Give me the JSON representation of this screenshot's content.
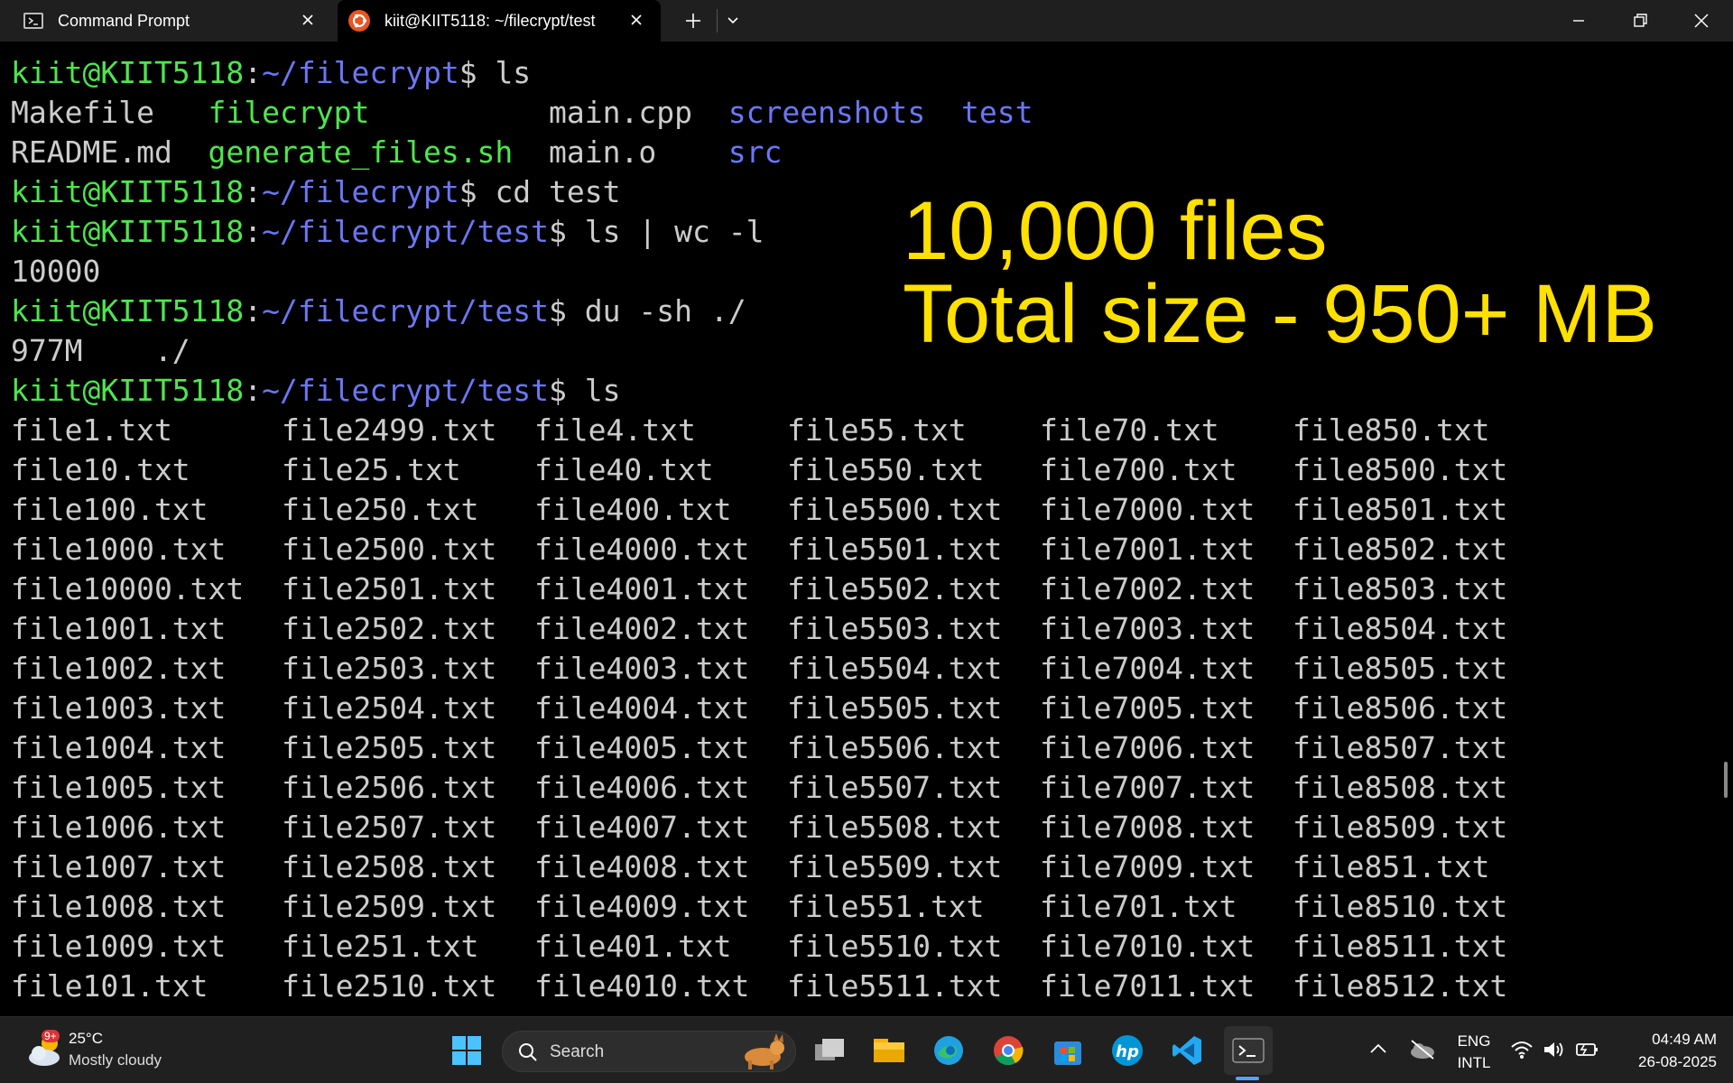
{
  "window": {
    "tabs": [
      {
        "label": "Command Prompt",
        "icon": "cmd-icon",
        "active": false
      },
      {
        "label": "kiit@KIIT5118: ~/filecrypt/test",
        "icon": "ubuntu-icon",
        "active": true
      }
    ],
    "controls": [
      "new-tab-icon",
      "dropdown-icon",
      "minimize-icon",
      "restore-icon",
      "close-icon"
    ]
  },
  "terminal": {
    "colors": {
      "prompt_user": "#4ee64e",
      "prompt_path": "#6b77f5",
      "text": "#cccccc",
      "overlay": "#ffe000"
    },
    "lines": [
      {
        "user": "kiit@KIIT5118",
        "sep": ":",
        "path": "~/filecrypt",
        "cmd": "$ ls"
      },
      {
        "text": "Makefile   ",
        "exec": "filecrypt",
        "text2": "          main.cpp  ",
        "dir1": "screenshots",
        "gap": "  ",
        "dir2": "test"
      },
      {
        "text": "README.md  ",
        "exec": "generate_files.sh",
        "text2": "  main.o    ",
        "dir1": "src"
      },
      {
        "user": "kiit@KIIT5118",
        "sep": ":",
        "path": "~/filecrypt",
        "cmd": "$ cd test"
      },
      {
        "user": "kiit@KIIT5118",
        "sep": ":",
        "path": "~/filecrypt/test",
        "cmd": "$ ls | wc -l"
      },
      {
        "text": "10000"
      },
      {
        "user": "kiit@KIIT5118",
        "sep": ":",
        "path": "~/filecrypt/test",
        "cmd": "$ du -sh ./"
      },
      {
        "text": "977M    ./"
      },
      {
        "user": "kiit@KIIT5118",
        "sep": ":",
        "path": "~/filecrypt/test",
        "cmd": "$ ls"
      }
    ],
    "file_columns": [
      [
        "file1.txt",
        "file10.txt",
        "file100.txt",
        "file1000.txt",
        "file10000.txt",
        "file1001.txt",
        "file1002.txt",
        "file1003.txt",
        "file1004.txt",
        "file1005.txt",
        "file1006.txt",
        "file1007.txt",
        "file1008.txt",
        "file1009.txt",
        "file101.txt"
      ],
      [
        "file2499.txt",
        "file25.txt",
        "file250.txt",
        "file2500.txt",
        "file2501.txt",
        "file2502.txt",
        "file2503.txt",
        "file2504.txt",
        "file2505.txt",
        "file2506.txt",
        "file2507.txt",
        "file2508.txt",
        "file2509.txt",
        "file251.txt",
        "file2510.txt"
      ],
      [
        "file4.txt",
        "file40.txt",
        "file400.txt",
        "file4000.txt",
        "file4001.txt",
        "file4002.txt",
        "file4003.txt",
        "file4004.txt",
        "file4005.txt",
        "file4006.txt",
        "file4007.txt",
        "file4008.txt",
        "file4009.txt",
        "file401.txt",
        "file4010.txt"
      ],
      [
        "file55.txt",
        "file550.txt",
        "file5500.txt",
        "file5501.txt",
        "file5502.txt",
        "file5503.txt",
        "file5504.txt",
        "file5505.txt",
        "file5506.txt",
        "file5507.txt",
        "file5508.txt",
        "file5509.txt",
        "file551.txt",
        "file5510.txt",
        "file5511.txt"
      ],
      [
        "file70.txt",
        "file700.txt",
        "file7000.txt",
        "file7001.txt",
        "file7002.txt",
        "file7003.txt",
        "file7004.txt",
        "file7005.txt",
        "file7006.txt",
        "file7007.txt",
        "file7008.txt",
        "file7009.txt",
        "file701.txt",
        "file7010.txt",
        "file7011.txt"
      ],
      [
        "file850.txt",
        "file8500.txt",
        "file8501.txt",
        "file8502.txt",
        "file8503.txt",
        "file8504.txt",
        "file8505.txt",
        "file8506.txt",
        "file8507.txt",
        "file8508.txt",
        "file8509.txt",
        "file851.txt",
        "file8510.txt",
        "file8511.txt",
        "file8512.txt"
      ]
    ],
    "overlay": {
      "line1": "10,000 files",
      "line2": "Total size - 950+ MB"
    }
  },
  "taskbar": {
    "weather": {
      "badge": "9+",
      "temp": "25°C",
      "desc": "Mostly cloudy"
    },
    "search_label": "Search",
    "apps": [
      "windows-start-icon",
      "search-icon",
      "task-view-icon",
      "file-explorer-icon",
      "edge-icon",
      "chrome-icon",
      "microsoft-store-icon",
      "hp-icon",
      "vscode-icon",
      "terminal-icon"
    ],
    "tray": {
      "lang1": "ENG",
      "lang2": "INTL",
      "time": "04:49 AM",
      "date": "26-08-2025"
    }
  }
}
